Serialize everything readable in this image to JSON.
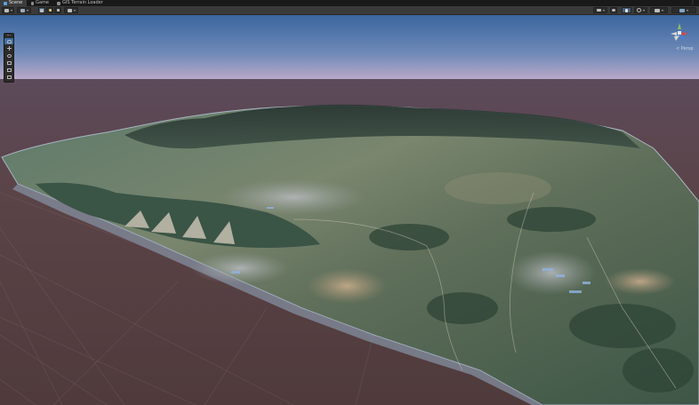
{
  "tabs": [
    {
      "label": "Scene",
      "active": true,
      "icon": "scene-hash-icon"
    },
    {
      "label": "Game",
      "active": false,
      "icon": "gamepad-icon"
    },
    {
      "label": "GIS Terrain Loader",
      "active": false,
      "icon": "terrain-icon"
    }
  ],
  "tab_menu_label": "⋮",
  "toolbar": {
    "left_tools": [
      "scene-options-dropdown",
      "shading-dropdown",
      "2d-toggle",
      "lighting-toggle",
      "audio-toggle",
      "effects-dropdown"
    ],
    "right_tools": [
      "camera-dropdown",
      "visibility-toggle",
      "gizmos-dropdown",
      "search-field",
      "layers-dropdown",
      "layout-dropdown"
    ]
  },
  "view_tools": [
    "hand-tool",
    "move-tool",
    "rotate-tool",
    "scale-tool",
    "rect-tool",
    "transform-tool"
  ],
  "active_view_tool": "hand-tool",
  "gizmo": {
    "label": "< Persp"
  },
  "colors": {
    "sky_top": "#3e6aa8",
    "sky_horizon": "#c9b0c2",
    "ground_plane": "#5a4245",
    "terrain_green": "#4a6a55",
    "accent": "#3e6fa3"
  }
}
